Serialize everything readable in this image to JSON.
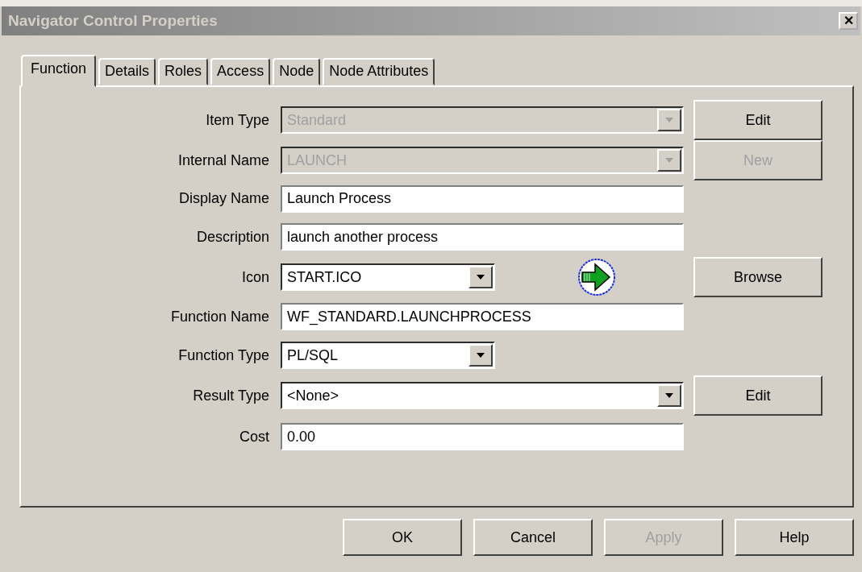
{
  "window": {
    "title": "Navigator Control Properties",
    "close": "✕"
  },
  "tabs": [
    {
      "label": "Function",
      "selected": true
    },
    {
      "label": "Details",
      "selected": false
    },
    {
      "label": "Roles",
      "selected": false
    },
    {
      "label": "Access",
      "selected": false
    },
    {
      "label": "Node",
      "selected": false
    },
    {
      "label": "Node Attributes",
      "selected": false
    }
  ],
  "fields": [
    {
      "label": "Item Type",
      "kind": "combo",
      "value": "Standard",
      "disabled": true,
      "button": {
        "label": "Edit",
        "disabled": false
      }
    },
    {
      "label": "Internal Name",
      "kind": "combo",
      "value": "LAUNCH",
      "disabled": true,
      "button": {
        "label": "New",
        "disabled": true
      }
    },
    {
      "label": "Display Name",
      "kind": "text",
      "value": "Launch Process",
      "disabled": false
    },
    {
      "label": "Description",
      "kind": "text",
      "value": "launch another process",
      "disabled": false
    },
    {
      "label": "Icon",
      "kind": "shortcombo",
      "value": "START.ICO",
      "disabled": false,
      "preview": true,
      "button": {
        "label": "Browse",
        "disabled": false
      }
    },
    {
      "label": "Function Name",
      "kind": "text",
      "value": "WF_STANDARD.LAUNCHPROCESS",
      "disabled": false
    },
    {
      "label": "Function Type",
      "kind": "shortcombo",
      "value": "PL/SQL",
      "disabled": false
    },
    {
      "label": "Result Type",
      "kind": "combo",
      "value": "<None>",
      "disabled": false,
      "button": {
        "label": "Edit",
        "disabled": false
      }
    },
    {
      "label": "Cost",
      "kind": "text",
      "value": "0.00",
      "disabled": false
    }
  ],
  "buttons": [
    {
      "label": "OK",
      "disabled": false
    },
    {
      "label": "Cancel",
      "disabled": false
    },
    {
      "label": "Apply",
      "disabled": true
    },
    {
      "label": "Help",
      "disabled": false
    }
  ]
}
